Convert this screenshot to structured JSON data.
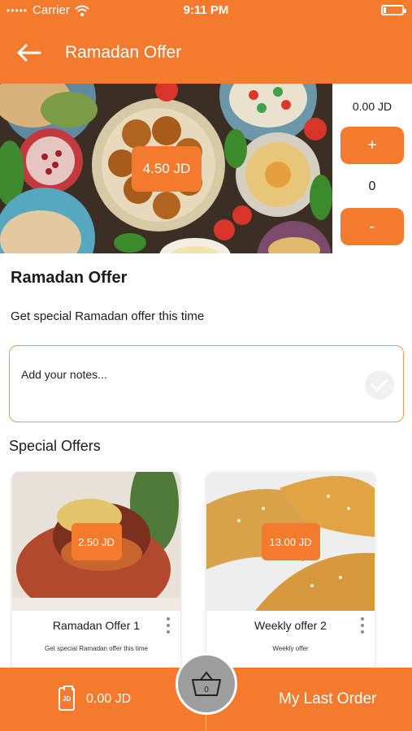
{
  "status_bar": {
    "carrier": "Carrier",
    "time": "9:11 PM"
  },
  "header": {
    "title": "Ramadan Offer"
  },
  "hero": {
    "price": "4.50 JD"
  },
  "quantity": {
    "total": "0.00 JD",
    "plus_label": "+",
    "count": "0",
    "minus_label": "-"
  },
  "product": {
    "title": "Ramadan Offer",
    "description": "Get special Ramadan offer this time"
  },
  "notes": {
    "placeholder": "Add your notes..."
  },
  "special_offers": {
    "heading": "Special Offers",
    "items": [
      {
        "price": "2.50 JD",
        "title": "Ramadan Offer 1",
        "subtitle": "Get special Ramadan offer this time"
      },
      {
        "price": "13.00 JD",
        "title": "Weekly offer 2",
        "subtitle": "Weekly offer"
      }
    ]
  },
  "bottom_bar": {
    "cart_total": "0.00 JD",
    "basket_count": "0",
    "last_order_label": "My Last Order"
  },
  "colors": {
    "accent": "#f47a2e"
  }
}
